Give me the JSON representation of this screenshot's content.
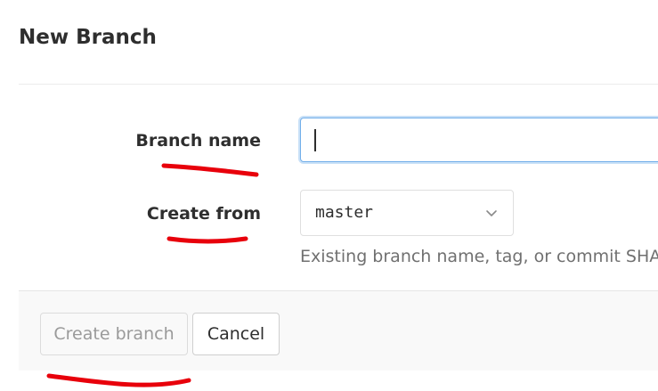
{
  "dialog": {
    "title": "New Branch"
  },
  "form": {
    "branch_name": {
      "label": "Branch name",
      "value": ""
    },
    "create_from": {
      "label": "Create from",
      "selected": "master",
      "help": "Existing branch name, tag, or commit SHA"
    }
  },
  "actions": {
    "create_label": "Create branch",
    "cancel_label": "Cancel"
  },
  "colors": {
    "focus_border": "#73afea",
    "annotation_red": "#e8000b"
  },
  "icons": {
    "select_caret": "chevron-down-icon"
  }
}
